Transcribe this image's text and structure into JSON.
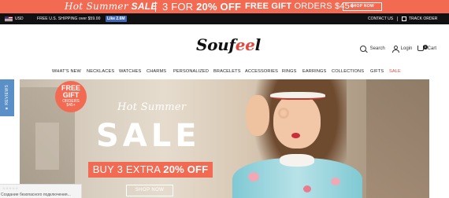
{
  "promo": {
    "hot_summer": "Hot Summer",
    "sale": "SALE",
    "deal_prefix": "3 FOR",
    "deal_value": "20% OFF",
    "gift_bold": "FREE GIFT",
    "gift_rest": "ORDERS $45+",
    "shop_now": "SHOP NOW"
  },
  "topbar": {
    "currency": "USD",
    "shipping": "FREE U.S. SHIPPING over $59.00",
    "like": "Like 2.6M",
    "contact": "CONTACT US",
    "track": "TRACK ORDER"
  },
  "header": {
    "logo_main": "Souf",
    "logo_heart": "ee",
    "logo_end": "l",
    "search": "Search",
    "login": "Login",
    "cart": "Cart",
    "cart_count": "0"
  },
  "nav": {
    "items": [
      "WHAT'S NEW",
      "NECKLACES",
      "WATCHES",
      "CHARMS",
      "PERSONALIZED",
      "BRACELETS",
      "ACCESSORIES",
      "RINGS",
      "EARRINGS",
      "COLLECTIONS",
      "GIFTS",
      "SALE"
    ]
  },
  "hero": {
    "badge_line1": "FREE",
    "badge_line2": "GIFT",
    "badge_line3": "ORDERS",
    "badge_line4": "$45+",
    "hot_summer": "Hot Summer",
    "sale": "SALE",
    "extra_prefix": "BUY 3 EXTRA",
    "extra_value": "20% OFF",
    "shop_now": "SHOP NOW"
  },
  "reviews_tab": "★ REVIEWS",
  "status": {
    "stars": "☆☆☆☆☆",
    "text": "Создание безопасного подключения..."
  },
  "colors": {
    "accent": "#f26a52",
    "topbar_bg": "#111111",
    "reviews_bg": "#5a8fc7",
    "sale_link": "#e0483f"
  }
}
